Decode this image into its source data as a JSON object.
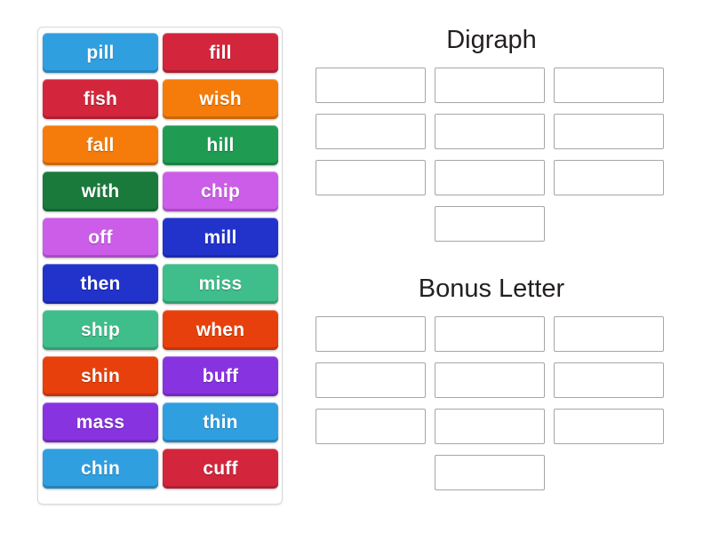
{
  "activity": {
    "type": "word-sort-drag-and-drop",
    "tile_pool": {
      "name": "word-tiles",
      "tiles": [
        {
          "label": "pill",
          "color": "#2f9fe0"
        },
        {
          "label": "fill",
          "color": "#d3263c"
        },
        {
          "label": "fish",
          "color": "#d3263c"
        },
        {
          "label": "wish",
          "color": "#f57c0a"
        },
        {
          "label": "fall",
          "color": "#f57c0a"
        },
        {
          "label": "hill",
          "color": "#1f9c52"
        },
        {
          "label": "with",
          "color": "#1a7a3c"
        },
        {
          "label": "chip",
          "color": "#cc5de8"
        },
        {
          "label": "off",
          "color": "#cc5de8"
        },
        {
          "label": "mill",
          "color": "#2233cc"
        },
        {
          "label": "then",
          "color": "#2233cc"
        },
        {
          "label": "miss",
          "color": "#3fbd8a"
        },
        {
          "label": "ship",
          "color": "#3fbd8a"
        },
        {
          "label": "when",
          "color": "#e8400c"
        },
        {
          "label": "shin",
          "color": "#e8400c"
        },
        {
          "label": "buff",
          "color": "#8833e0"
        },
        {
          "label": "mass",
          "color": "#8833e0"
        },
        {
          "label": "thin",
          "color": "#2f9fe0"
        },
        {
          "label": "chin",
          "color": "#2f9fe0"
        },
        {
          "label": "cuff",
          "color": "#d3263c"
        }
      ]
    },
    "categories": [
      {
        "id": "digraph",
        "title": "Digraph",
        "slots": [
          "",
          "",
          "",
          "",
          "",
          "",
          "",
          "",
          "",
          ""
        ],
        "slot_count": 10
      },
      {
        "id": "bonus-letter",
        "title": "Bonus Letter",
        "slots": [
          "",
          "",
          "",
          "",
          "",
          "",
          "",
          "",
          "",
          ""
        ],
        "slot_count": 10
      }
    ]
  },
  "colors": {
    "page_background": "#ffffff",
    "pool_border": "#d9d9d9",
    "slot_border": "#a6a6a6",
    "title_text": "#231f20",
    "tile_text": "#ffffff"
  }
}
